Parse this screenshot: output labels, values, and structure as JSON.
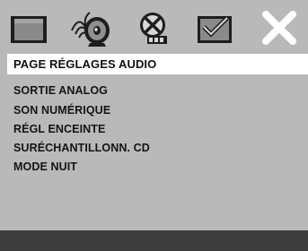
{
  "colors": {
    "background": "#b9b9b9",
    "header_background": "#ffffff",
    "footer_background": "#3d3d3d",
    "text": "#141414",
    "close_icon": "#ffffff"
  },
  "tabs": [
    {
      "icon": "general-setup-icon",
      "selected": false
    },
    {
      "icon": "audio-setup-icon",
      "selected": true
    },
    {
      "icon": "dolby-digital-icon",
      "selected": false
    },
    {
      "icon": "preference-check-icon",
      "selected": false
    },
    {
      "icon": "close-icon",
      "selected": false
    }
  ],
  "header": {
    "title": "PAGE RÉGLAGES AUDIO"
  },
  "menu": {
    "items": [
      {
        "label": "SORTIE ANALOG"
      },
      {
        "label": "SON NUMÉRIQUE"
      },
      {
        "label": "RÉGL ENCEINTE"
      },
      {
        "label": "SURÉCHANTILLONN. CD"
      },
      {
        "label": "MODE NUIT"
      }
    ]
  }
}
